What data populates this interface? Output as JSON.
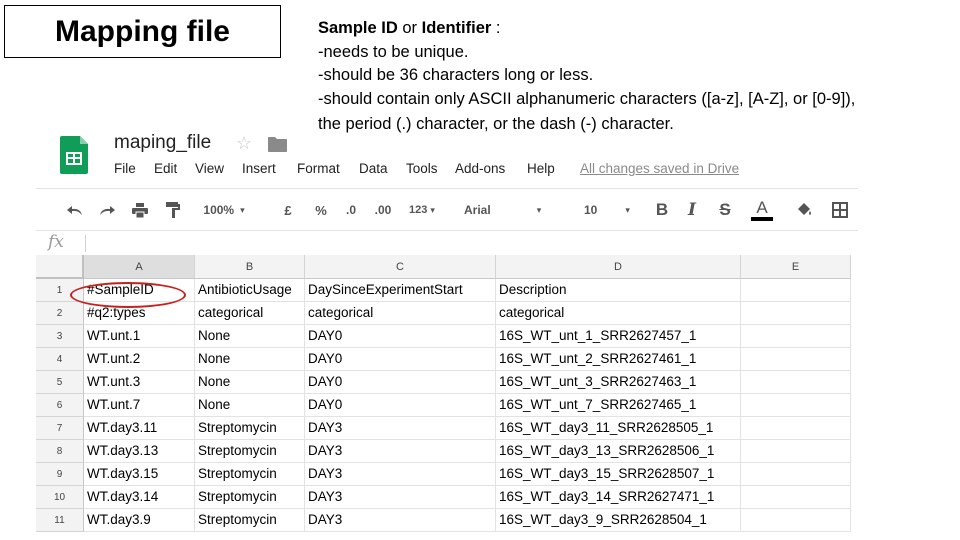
{
  "slide": {
    "title": "Mapping file",
    "notes": {
      "intro_bold_1": "Sample ID",
      "intro_mid": " or ",
      "intro_bold_2": "Identifier",
      "intro_end": " :",
      "lines": [
        "-needs to be unique.",
        "-should be 36 characters long or less.",
        "-should contain only ASCII alphanumeric characters ([a-z], [A-Z], or [0-9]),",
        "the period (.) character, or the dash (-) character."
      ]
    }
  },
  "sheets": {
    "doc_title": "maping_file",
    "icons": {
      "star": "star-icon",
      "folder": "folder-icon",
      "logo": "sheets-logo-icon"
    },
    "menu": [
      "File",
      "Edit",
      "View",
      "Insert",
      "Format",
      "Data",
      "Tools",
      "Add-ons",
      "Help"
    ],
    "saved_status": "All changes saved in Drive",
    "toolbar": {
      "zoom": "100%",
      "currency": "£",
      "percent": "%",
      "dec_decrease": ".0",
      "dec_increase": ".00",
      "more_formats": "123",
      "font": "Arial",
      "font_size": "10",
      "bold": "B",
      "italic": "I",
      "strike": "S",
      "text_color": "A"
    },
    "fx_label": "fx",
    "columns": [
      "A",
      "B",
      "C",
      "D",
      "E"
    ],
    "rows": [
      {
        "num": "1",
        "cells": [
          "#SampleID",
          "AntibioticUsage",
          "DaySinceExperimentStart",
          "Description",
          ""
        ]
      },
      {
        "num": "2",
        "cells": [
          "#q2:types",
          "categorical",
          "categorical",
          "categorical",
          ""
        ]
      },
      {
        "num": "3",
        "cells": [
          "WT.unt.1",
          "None",
          "DAY0",
          "16S_WT_unt_1_SRR2627457_1",
          ""
        ]
      },
      {
        "num": "4",
        "cells": [
          "WT.unt.2",
          "None",
          "DAY0",
          "16S_WT_unt_2_SRR2627461_1",
          ""
        ]
      },
      {
        "num": "5",
        "cells": [
          "WT.unt.3",
          "None",
          "DAY0",
          "16S_WT_unt_3_SRR2627463_1",
          ""
        ]
      },
      {
        "num": "6",
        "cells": [
          "WT.unt.7",
          "None",
          "DAY0",
          "16S_WT_unt_7_SRR2627465_1",
          ""
        ]
      },
      {
        "num": "7",
        "cells": [
          "WT.day3.11",
          "Streptomycin",
          "DAY3",
          "16S_WT_day3_11_SRR2628505_1",
          ""
        ]
      },
      {
        "num": "8",
        "cells": [
          "WT.day3.13",
          "Streptomycin",
          "DAY3",
          "16S_WT_day3_13_SRR2628506_1",
          ""
        ]
      },
      {
        "num": "9",
        "cells": [
          "WT.day3.15",
          "Streptomycin",
          "DAY3",
          "16S_WT_day3_15_SRR2628507_1",
          ""
        ]
      },
      {
        "num": "10",
        "cells": [
          "WT.day3.14",
          "Streptomycin",
          "DAY3",
          "16S_WT_day3_14_SRR2627471_1",
          ""
        ]
      },
      {
        "num": "11",
        "cells": [
          "WT.day3.9",
          "Streptomycin",
          "DAY3",
          "16S_WT_day3_9_SRR2628504_1",
          ""
        ]
      }
    ],
    "colors": {
      "sheets_green": "#0f9d58",
      "annotation_red": "#c8201f"
    }
  }
}
